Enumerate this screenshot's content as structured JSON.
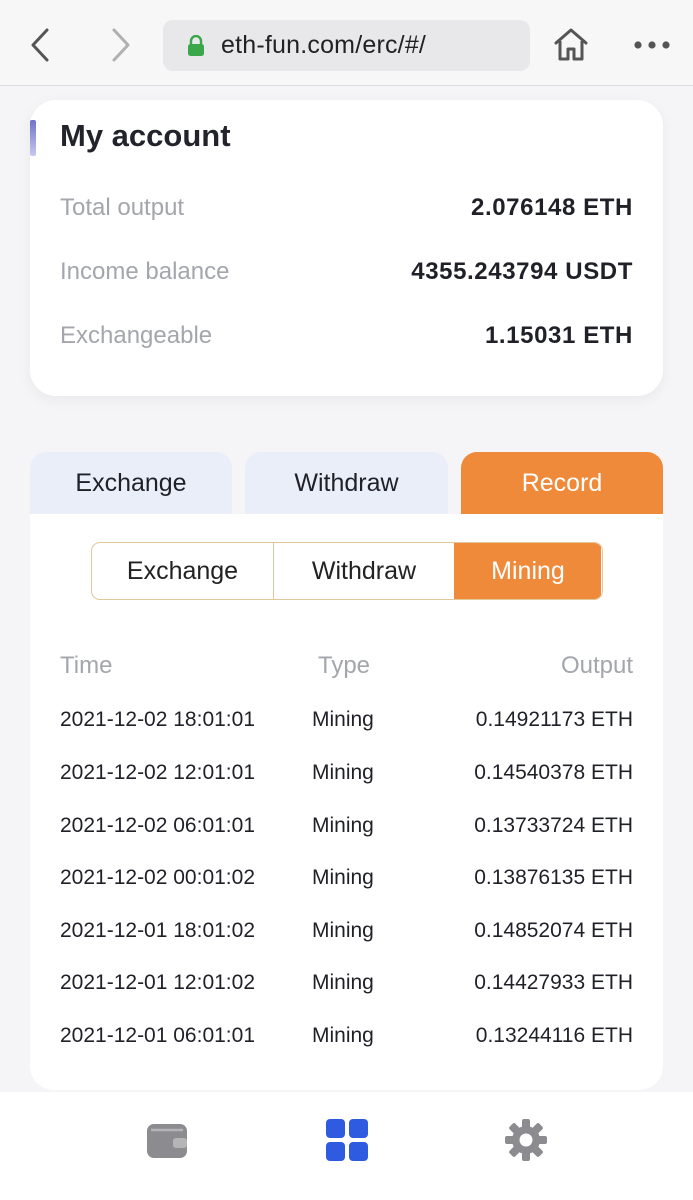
{
  "browser": {
    "url": "eth-fun.com/erc/#/"
  },
  "account": {
    "title": "My account",
    "rows": [
      {
        "label": "Total output",
        "value": "2.076148 ETH"
      },
      {
        "label": "Income balance",
        "value": "4355.243794 USDT"
      },
      {
        "label": "Exchangeable",
        "value": "1.15031 ETH"
      }
    ]
  },
  "tabs": {
    "items": [
      "Exchange",
      "Withdraw",
      "Record"
    ],
    "active": "Record"
  },
  "record_filter": {
    "items": [
      "Exchange",
      "Withdraw",
      "Mining"
    ],
    "active": "Mining"
  },
  "table": {
    "headers": {
      "time": "Time",
      "type": "Type",
      "output": "Output"
    },
    "rows": [
      {
        "time": "2021-12-02 18:01:01",
        "type": "Mining",
        "output": "0.14921173 ETH"
      },
      {
        "time": "2021-12-02 12:01:01",
        "type": "Mining",
        "output": "0.14540378 ETH"
      },
      {
        "time": "2021-12-02 06:01:01",
        "type": "Mining",
        "output": "0.13733724 ETH"
      },
      {
        "time": "2021-12-02 00:01:02",
        "type": "Mining",
        "output": "0.13876135 ETH"
      },
      {
        "time": "2021-12-01 18:01:02",
        "type": "Mining",
        "output": "0.14852074 ETH"
      },
      {
        "time": "2021-12-01 12:01:02",
        "type": "Mining",
        "output": "0.14427933 ETH"
      },
      {
        "time": "2021-12-01 06:01:01",
        "type": "Mining",
        "output": "0.13244116 ETH"
      }
    ]
  },
  "colors": {
    "accent": "#ef8a3a",
    "tab_inactive": "#e9eef8",
    "nav_active": "#2f5be0",
    "nav_inactive": "#8c8c90"
  },
  "bottom_nav": {
    "items": [
      "wallet-icon",
      "grid-icon",
      "gear-icon"
    ],
    "active": "grid-icon"
  }
}
